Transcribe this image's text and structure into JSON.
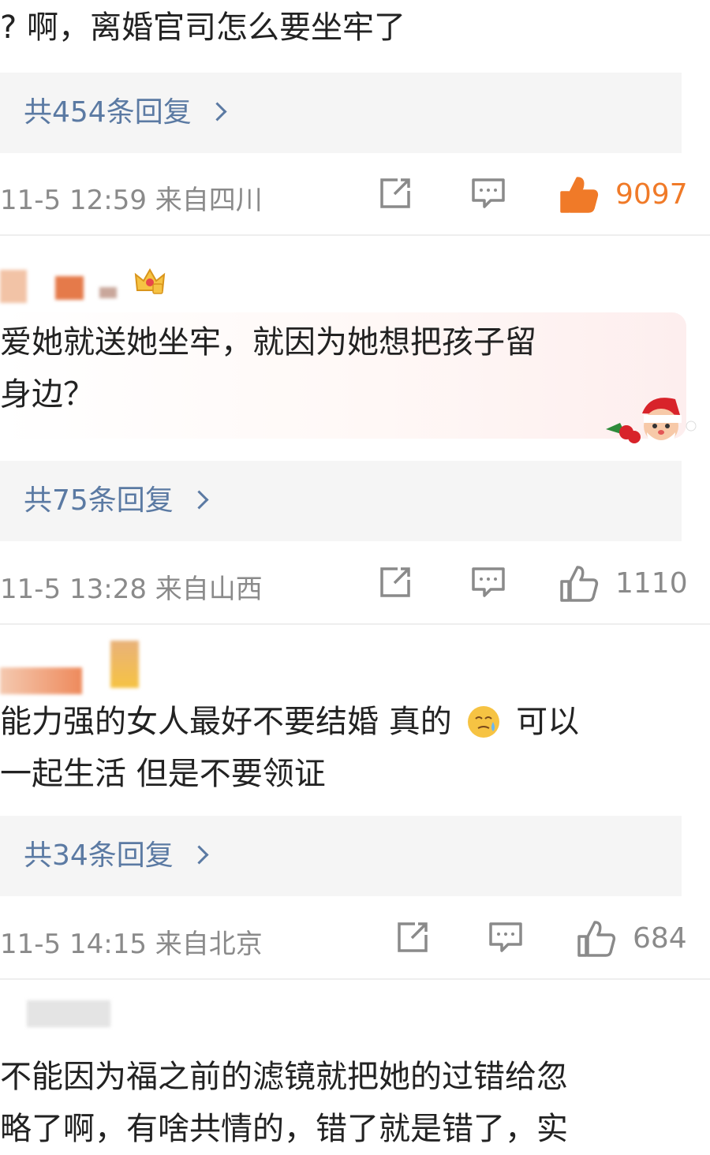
{
  "comments": [
    {
      "text_lines": [
        "? 啊，离婚官司怎么要坐牢了"
      ],
      "replies_label": "共454条回复",
      "time": "11-5 12:59",
      "location": "来自四川",
      "likes": "9097",
      "liked": true
    },
    {
      "text_lines": [
        "爱她就送她坐牢，就因为她想把孩子留",
        "身边？"
      ],
      "replies_label": "共75条回复",
      "time": "11-5 13:28",
      "location": "来自山西",
      "likes": "1110",
      "liked": false
    },
    {
      "text_line1_a": "能力强的女人最好不要结婚 真的",
      "text_line1_b": "可以",
      "text_line2": "一起生活 但是不要领证",
      "replies_label": "共34条回复",
      "time": "11-5 14:15",
      "location": "来自北京",
      "likes": "684",
      "liked": false
    },
    {
      "text_lines": [
        "不能因为福之前的滤镜就把她的过错给忽",
        "略了啊，有啥共情的，错了就是错了，实"
      ]
    }
  ],
  "icons": {
    "share": "share-icon",
    "comment": "comment-icon",
    "like": "thumbs-up-icon"
  },
  "colors": {
    "link": "#5b7aa3",
    "liked": "#f07a28",
    "meta": "#8a8a8a",
    "reply_bg": "#f5f5f5"
  }
}
